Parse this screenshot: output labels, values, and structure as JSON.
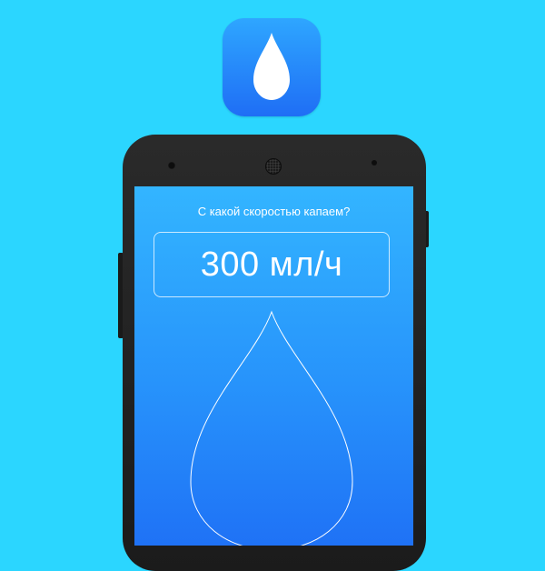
{
  "icon": {
    "name": "water-drop-icon",
    "colors": {
      "gradient_top": "#2ea6ff",
      "gradient_bottom": "#1f6ef5",
      "glyph": "#ffffff"
    }
  },
  "background_color": "#2bd6ff",
  "device": {
    "type": "android-phone",
    "screen": {
      "prompt": "С какой скоростью капаем?",
      "rate_value": "300 мл/ч",
      "illustration": "water-drop-outline-icon",
      "colors": {
        "gradient_top": "#33b5ff",
        "gradient_bottom": "#1f72f6",
        "text": "#ffffff"
      }
    }
  }
}
